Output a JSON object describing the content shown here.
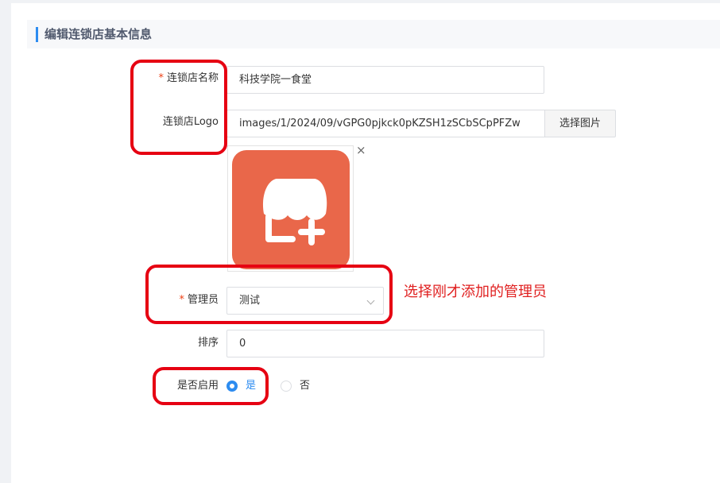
{
  "section": {
    "title": "编辑连锁店基本信息"
  },
  "form": {
    "name": {
      "required_mark": "*",
      "label": "连锁店名称",
      "value": "科技学院一食堂"
    },
    "logo": {
      "label": "连锁店Logo",
      "value": "images/1/2024/09/vGPG0pjkck0pKZSH1zSCbSCpPFZw",
      "button_label": "选择图片",
      "remove_label": "×"
    },
    "manager": {
      "required_mark": "*",
      "label": "管理员",
      "value": "测试"
    },
    "sort": {
      "label": "排序",
      "value": "0"
    },
    "enabled": {
      "label": "是否启用",
      "options": [
        "是",
        "否"
      ],
      "selected": "是"
    }
  },
  "annotation": {
    "text": "选择刚才添加的管理员",
    "color": "#e02020"
  },
  "colors": {
    "accent": "#2d8cf0",
    "required": "#ed4014",
    "highlight": "#e60012",
    "logo_bg": "#e9674a"
  },
  "icons": {
    "logo_image": "store-add-icon",
    "remove": "close-icon",
    "dropdown": "chevron-down-icon"
  }
}
